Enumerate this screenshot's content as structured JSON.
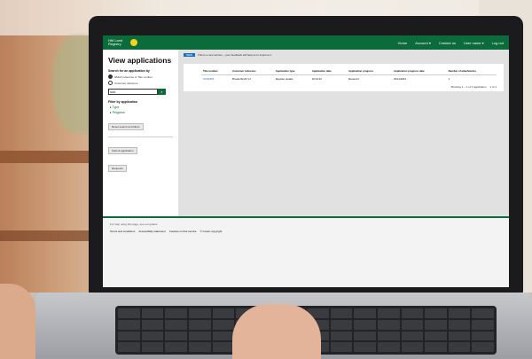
{
  "app": {
    "logo_text": "HM Land Registry",
    "nav": [
      "Home",
      "Account ▾",
      "Contact us",
      "User name ▾",
      "Log out"
    ]
  },
  "sidebar": {
    "title": "View applications",
    "search_label": "Search for an application by",
    "radio_options": [
      "HMLR reference or Title number",
      "Customer reference"
    ],
    "search_value": "SKD",
    "filter_label": "Filter by application",
    "filters": [
      "Type",
      "Progress"
    ],
    "reset_button": "Reset search and filters",
    "submit_button": "Submit application",
    "requisitions_button": "Requests"
  },
  "main": {
    "tag": "NEW",
    "notice": "This is a new service – your feedback will help us to improve it.",
    "columns": [
      "Title number",
      "Customer reference",
      "Application type",
      "Application date",
      "Application progress",
      "Application progress date",
      "Number of attachments"
    ],
    "rows": [
      [
        "SCD1803",
        "Brooks/Smith V1",
        "Register update",
        "20.04.22",
        "Received",
        "20/11/2023",
        "1"
      ]
    ],
    "pager_text": "Showing 1 – 1 of 1 application",
    "pager_nav": "1 of 1"
  },
  "footer": {
    "help_text": "For help using this page, see our guides",
    "links": [
      "Terms and conditions",
      "Accessibility statement",
      "Cookies on this service",
      "© Crown copyright"
    ]
  },
  "colors": {
    "brand": "#0b6b3a",
    "accent": "#f3d21c",
    "link": "#1d70b8"
  }
}
